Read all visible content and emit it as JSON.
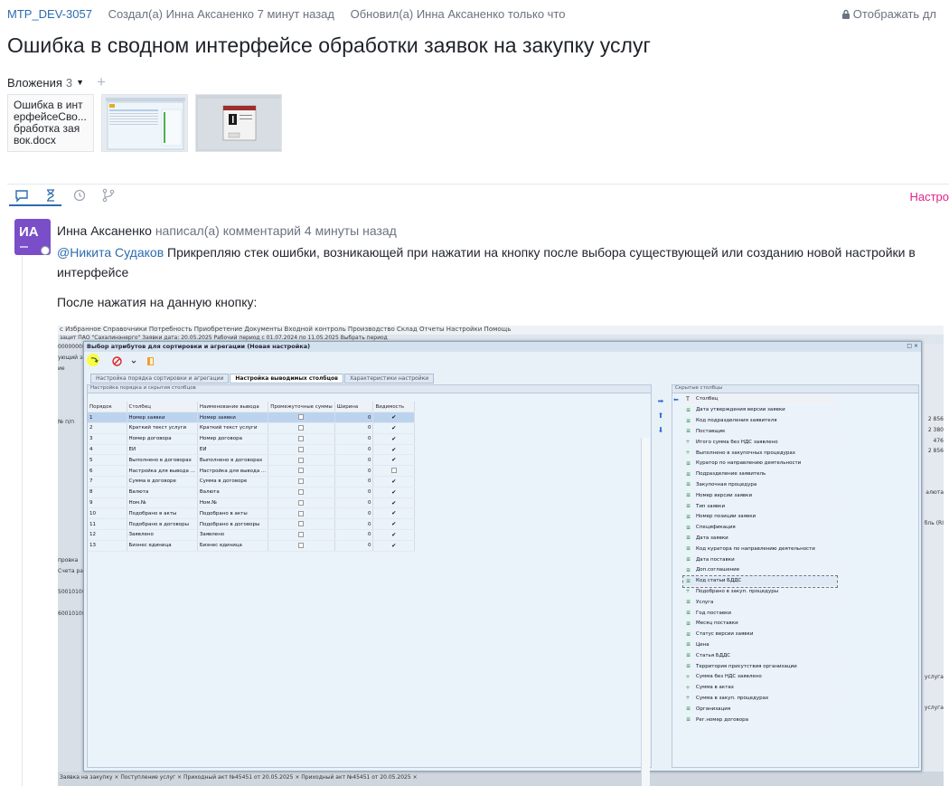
{
  "header": {
    "issue_key": "MTP_DEV-3057",
    "created": "Создал(а) Инна Аксаненко 7 минут назад",
    "updated": "Обновил(а) Инна Аксаненко только что",
    "visibility": "Отображать дл"
  },
  "title": "Ошибка в сводном интерфейсе обработки заявок на закупку услуг",
  "attachments": {
    "label": "Вложения",
    "count": "3",
    "items": [
      {
        "name": "Ошибка в интерфейсеСводная обработка заявок.docx",
        "display": "Ошибка в инт ерфейсеСво... бработка зая вок.docx"
      },
      {
        "name": "screenshot-1"
      },
      {
        "name": "screenshot-2"
      }
    ]
  },
  "activity_tabs": {
    "right_label": "Настро"
  },
  "comment": {
    "avatar_initials": "ИА",
    "author": "Инна Аксаненко",
    "action": "написал(а) комментарий 4 минуты назад",
    "mention": "@Никита Судаков",
    "text": "Прикрепляю стек ошибки, возникающей при нажатии на кнопку после выбора существующей или созданию новой настройки в интерфейсе",
    "text2": "После нажатия на данную кнопку:"
  },
  "screenshot": {
    "bg_menu": "с   Избранное   Справочники   Потребность   Приобретение   Документы   Входной контроль   Производство   Склад   Отчеты   Настройки   Помощь",
    "bg_bar": "зацит   ПАО \"Сахалинэнерго\"                    Заявки дата: 20.05.2025      Рабочий период с 01.07.2024      по 11.05.2025      Выбрать период",
    "bg_left": [
      "000000082",
      "ующий за",
      "ие",
      "",
      "",
      "",
      "",
      "№ п/п",
      "",
      "",
      "",
      "",
      "",
      "",
      "",
      "",
      "",
      "",
      "",
      "",
      "провка",
      "Счета расч",
      "",
      "50010100",
      "",
      "60010100"
    ],
    "bg_right": [
      "2 856",
      "2 380",
      "476",
      "2 856",
      "",
      "",
      "алюта",
      "",
      "бль (RI",
      "",
      "",
      "",
      "",
      "",
      "",
      "",
      "",
      "",
      "услуга",
      "",
      "услуга"
    ],
    "bg_bottom": "Заявка на закупку  ×   Поступление услуг  ×   Приходный акт №45451 от 20.05.2025  ×   Приходный акт №45451 от 20.05.2025  ×",
    "dialog_title": "Выбор атрибутов для сортировки и агрегации (Новая настройка)",
    "dialog_controls": "□ ×",
    "tabs": [
      "Настройка порядка сортировки и агрегации",
      "Настройка выводимых столбцов",
      "Характеристики настройки"
    ],
    "left_panel_title": "Настройка порядка и скрытия столбцов",
    "columns": [
      "Порядок",
      "Столбец",
      "Наименование вывода",
      "Промежуточные суммы",
      "Ширина",
      "Видимость"
    ],
    "rows": [
      {
        "order": "1",
        "col": "Номер заявки",
        "name": "Номер заявки",
        "width": "0",
        "sum": false,
        "vis": true
      },
      {
        "order": "2",
        "col": "Краткий текст услуги",
        "name": "Краткий текст услуги",
        "width": "0",
        "sum": false,
        "vis": true
      },
      {
        "order": "3",
        "col": "Номер договора",
        "name": "Номер договора",
        "width": "0",
        "sum": false,
        "vis": true
      },
      {
        "order": "4",
        "col": "ЕИ",
        "name": "ЕИ",
        "width": "0",
        "sum": false,
        "vis": true
      },
      {
        "order": "5",
        "col": "Выполнено в договорах",
        "name": "Выполнено в договорах",
        "width": "0",
        "sum": false,
        "vis": true
      },
      {
        "order": "6",
        "col": "Настройка для вывода ...",
        "name": "Настройка для вывода ...",
        "width": "0",
        "sum": false,
        "vis": false
      },
      {
        "order": "7",
        "col": "Сумма в договоре",
        "name": "Сумма в договоре",
        "width": "0",
        "sum": false,
        "vis": true
      },
      {
        "order": "8",
        "col": "Валюта",
        "name": "Валюта",
        "width": "0",
        "sum": false,
        "vis": true
      },
      {
        "order": "9",
        "col": "Ном.№",
        "name": "Ном.№",
        "width": "0",
        "sum": false,
        "vis": true
      },
      {
        "order": "10",
        "col": "Подобрано в акты",
        "name": "Подобрано в акты",
        "width": "0",
        "sum": false,
        "vis": true
      },
      {
        "order": "11",
        "col": "Подобрано в договоры",
        "name": "Подобрано в договоры",
        "width": "0",
        "sum": false,
        "vis": true
      },
      {
        "order": "12",
        "col": "Заявлено",
        "name": "Заявлено",
        "width": "0",
        "sum": false,
        "vis": true
      },
      {
        "order": "13",
        "col": "Бизнес единица",
        "name": "Бизнес единица",
        "width": "0",
        "sum": false,
        "vis": true
      }
    ],
    "check_mark": "✔",
    "right_panel_title": "Скрытые столбцы",
    "right_header": {
      "t": "Т",
      "col": "Столбец"
    },
    "hidden_columns": [
      {
        "icon": "bars",
        "label": "Дата утверждения версии заявки"
      },
      {
        "icon": "bars",
        "label": "Код подразделения заявителя"
      },
      {
        "icon": "bars",
        "label": "Поставщик"
      },
      {
        "icon": "plus",
        "label": "Итого сумма без НДС заявлено"
      },
      {
        "icon": "plus",
        "label": "Выполнено в закупочных процедурах"
      },
      {
        "icon": "bars",
        "label": "Куратор по направлению деятельности"
      },
      {
        "icon": "bars",
        "label": "Подразделение заявитель"
      },
      {
        "icon": "bars",
        "label": "Закупочная процедура"
      },
      {
        "icon": "bars",
        "label": "Номер версии заявки"
      },
      {
        "icon": "bars",
        "label": "Тип заявки"
      },
      {
        "icon": "bars",
        "label": "Номер позиции заявки"
      },
      {
        "icon": "bars",
        "label": "Спецификация"
      },
      {
        "icon": "bars",
        "label": "Дата заявки"
      },
      {
        "icon": "bars",
        "label": "Код куратора по направлению деятельности"
      },
      {
        "icon": "bars",
        "label": "Дата поставки"
      },
      {
        "icon": "bars",
        "label": "Доп.соглашение"
      },
      {
        "icon": "bars",
        "label": "Код статьи БДДС",
        "selected": true
      },
      {
        "icon": "plus",
        "label": "Подобрано в закуп. процедуры"
      },
      {
        "icon": "bars",
        "label": "Услуга"
      },
      {
        "icon": "bars",
        "label": "Год поставки"
      },
      {
        "icon": "bars",
        "label": "Месяц поставки"
      },
      {
        "icon": "bars",
        "label": "Статус версии заявки"
      },
      {
        "icon": "bars",
        "label": "Цена"
      },
      {
        "icon": "bars",
        "label": "Статья БДДС"
      },
      {
        "icon": "bars",
        "label": "Территория присутствия организации"
      },
      {
        "icon": "plus",
        "label": "Сумма без НДС заявлено"
      },
      {
        "icon": "plus",
        "label": "Сумма в актах"
      },
      {
        "icon": "plus",
        "label": "Сумма в закуп. процедурах"
      },
      {
        "icon": "bars",
        "label": "Организация"
      },
      {
        "icon": "bars",
        "label": "Рег.номер договора"
      }
    ],
    "arrows": {
      "right": "➡",
      "up": "⬆",
      "down": "⬇",
      "left": "⬅"
    }
  }
}
